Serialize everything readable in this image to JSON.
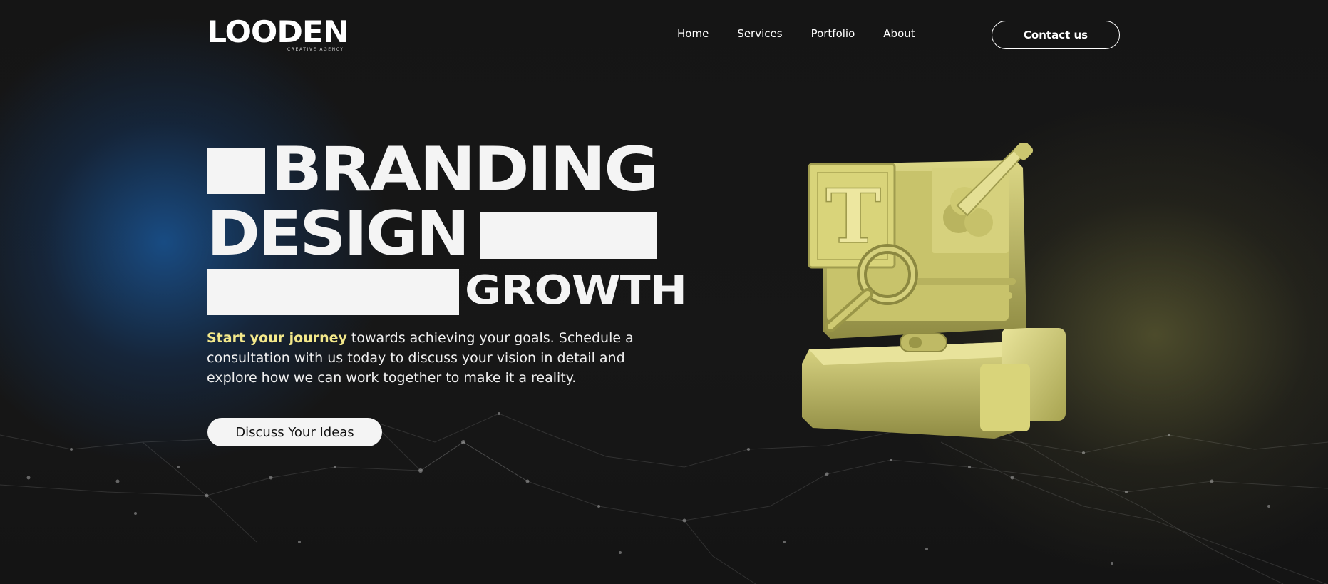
{
  "brand": {
    "name": "LOODEN",
    "tagline": "CREATIVE AGENCY"
  },
  "nav": {
    "items": [
      {
        "label": "Home"
      },
      {
        "label": "Services"
      },
      {
        "label": "Portfolio"
      },
      {
        "label": "About"
      }
    ],
    "contact_label": "Contact us"
  },
  "hero": {
    "line1": "BRANDING",
    "line2": "DESIGN",
    "line3": "GROWTH",
    "highlight": "Start your journey",
    "description": " towards achieving your goals. Schedule a consultation with us today to discuss your vision in detail and explore how we can work together to make it a reality.",
    "cta_label": "Discuss Your Ideas"
  },
  "illustration": {
    "name": "design-tools-3d-illustration",
    "icon_letter": "T"
  },
  "colors": {
    "background": "#141414",
    "accent_yellow": "#f3e88a",
    "illustration_yellow": "#d9d47a",
    "glow_blue": "#1955a0",
    "text": "#ffffff"
  }
}
